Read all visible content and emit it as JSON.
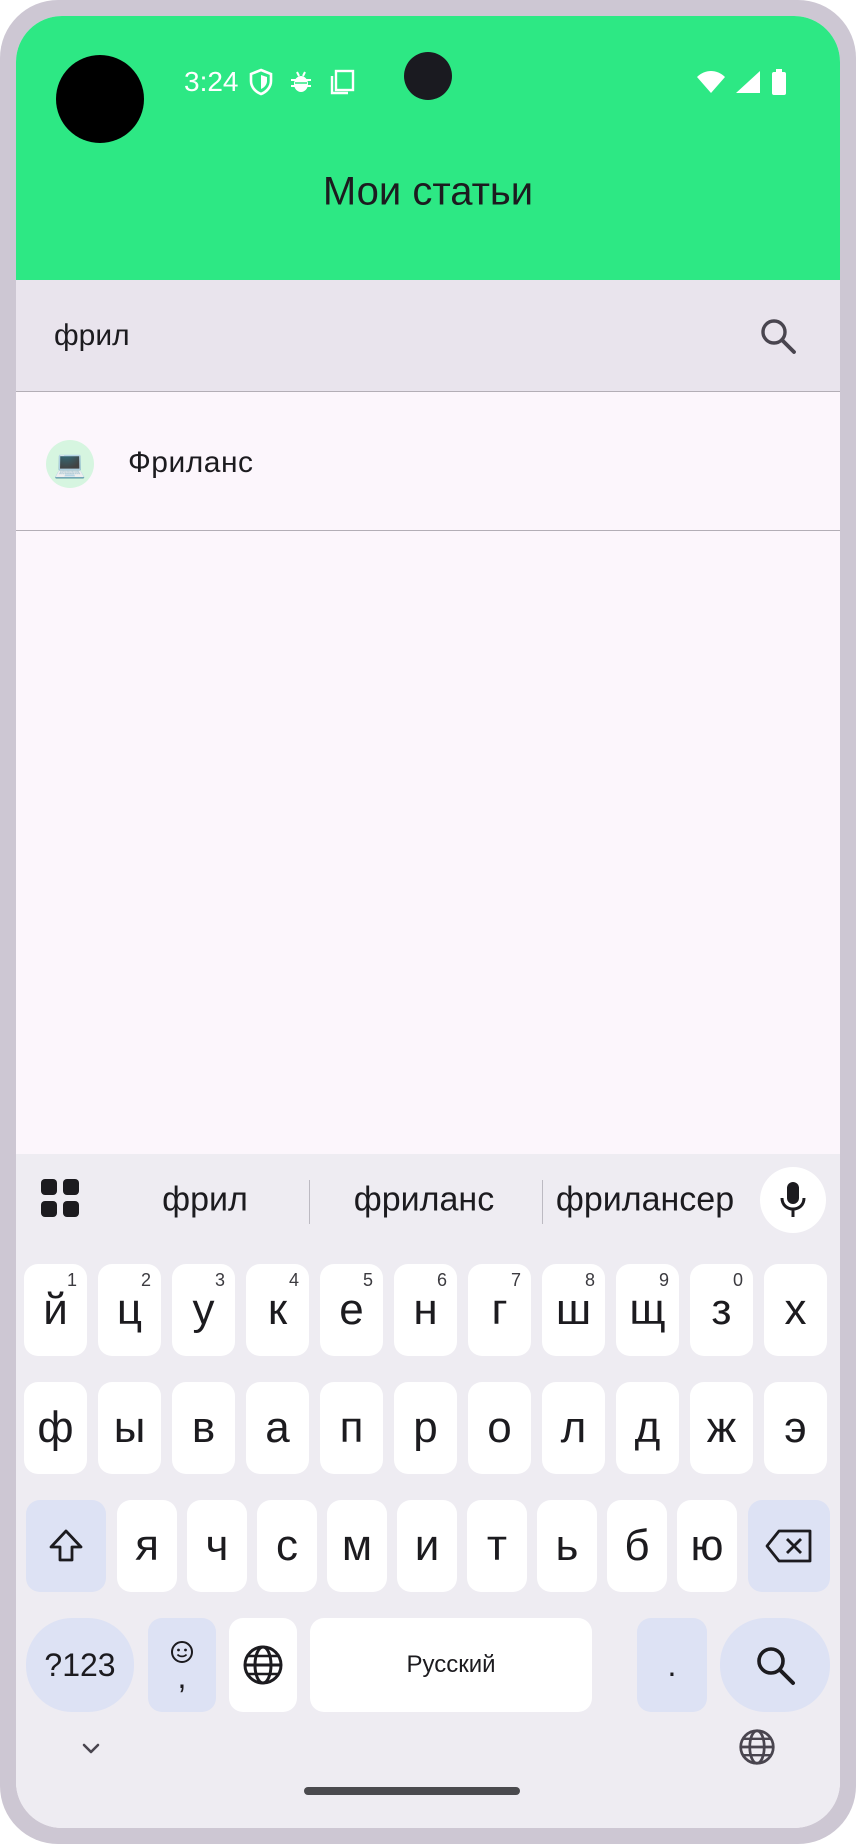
{
  "status_bar": {
    "time": "3:24",
    "left_icons": [
      "shield-icon",
      "bug-icon",
      "clipboard-icon"
    ],
    "right_icons": [
      "wifi-icon",
      "signal-icon",
      "battery-icon"
    ]
  },
  "app_bar": {
    "title": "Мои статьи",
    "color": "#2de884"
  },
  "search": {
    "value": "фрил",
    "icon": "search-icon"
  },
  "results": [
    {
      "icon": "laptop-emoji",
      "emoji": "💻",
      "label": "Фриланс"
    }
  ],
  "keyboard": {
    "suggestions": [
      "фрил",
      "фриланс",
      "фрилансер"
    ],
    "row1": [
      {
        "k": "й",
        "h": "1"
      },
      {
        "k": "ц",
        "h": "2"
      },
      {
        "k": "у",
        "h": "3"
      },
      {
        "k": "к",
        "h": "4"
      },
      {
        "k": "е",
        "h": "5"
      },
      {
        "k": "н",
        "h": "6"
      },
      {
        "k": "г",
        "h": "7"
      },
      {
        "k": "ш",
        "h": "8"
      },
      {
        "k": "щ",
        "h": "9"
      },
      {
        "k": "з",
        "h": "0"
      },
      {
        "k": "х",
        "h": ""
      }
    ],
    "row2": [
      "ф",
      "ы",
      "в",
      "а",
      "п",
      "р",
      "о",
      "л",
      "д",
      "ж",
      "э"
    ],
    "row3": [
      "я",
      "ч",
      "с",
      "м",
      "и",
      "т",
      "ь",
      "б",
      "ю"
    ],
    "symbols_label": "?123",
    "emoji_comma": ",",
    "space_label": "Русский",
    "period_label": "."
  }
}
